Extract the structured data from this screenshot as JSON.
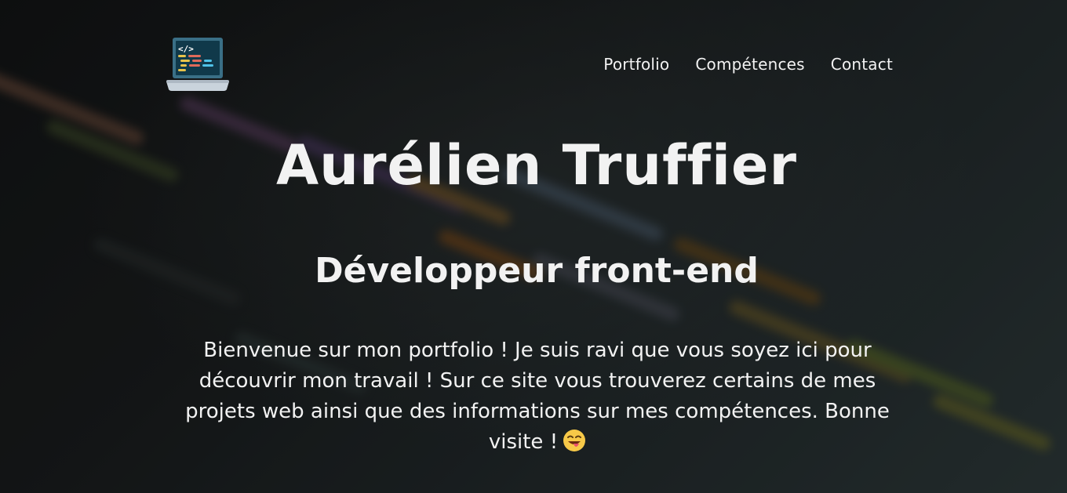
{
  "header": {
    "logo_icon": "laptop-code-icon",
    "nav": [
      {
        "label": "Portfolio"
      },
      {
        "label": "Compétences"
      },
      {
        "label": "Contact"
      }
    ]
  },
  "hero": {
    "name": "Aurélien Truffier",
    "role": "Développeur front-end",
    "intro": "Bienvenue sur mon portfolio ! Je suis ravi que vous soyez ici pour découvrir mon travail ! Sur ce site vous trouverez certains de mes projets web ainsi que des informations sur mes compétences. Bonne visite !",
    "emoji_icon": "winking-face-tongue-icon"
  },
  "colors": {
    "text": "#f2f2f2",
    "background": "#1b1e1f"
  }
}
